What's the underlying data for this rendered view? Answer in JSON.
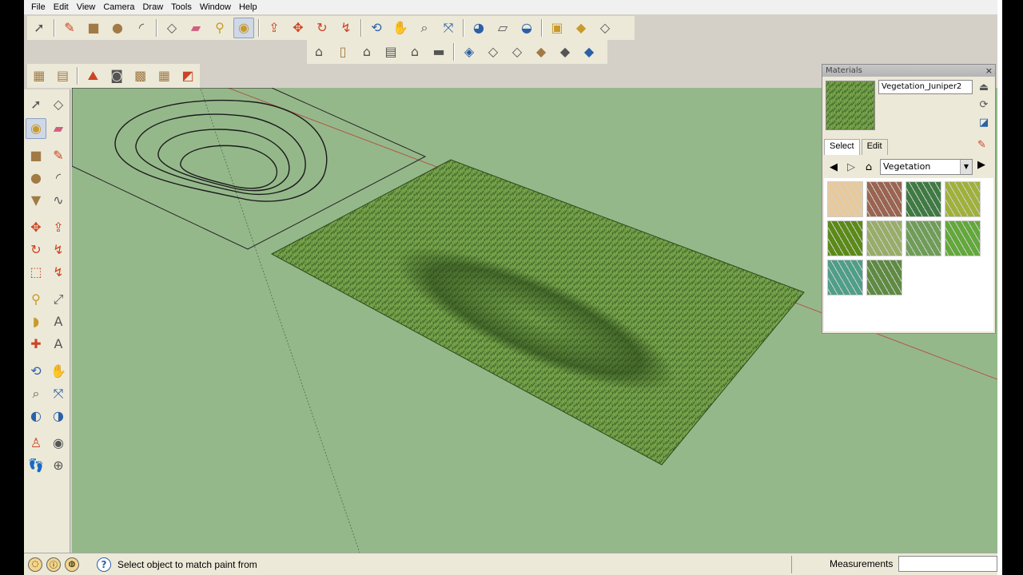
{
  "menu": [
    "File",
    "Edit",
    "View",
    "Camera",
    "Draw",
    "Tools",
    "Window",
    "Help"
  ],
  "toolbar_icons": [
    "select-icon",
    "pencil-icon",
    "rectangle-icon",
    "circle-icon",
    "arc-icon",
    "eraser-icon",
    "paint-bucket-icon",
    "push-pull-icon",
    "move-icon",
    "rotate-icon",
    "offset-icon",
    "orbit-icon",
    "pan-icon",
    "zoom-icon",
    "zoom-extents-icon"
  ],
  "materials_panel": {
    "title": "Materials",
    "close": "×",
    "name_value": "Vegetation_Juniper2",
    "tabs": [
      "Select",
      "Edit"
    ],
    "library": "Vegetation",
    "swatch_colors": [
      "#e8c99a",
      "#9a6450",
      "#3f7a43",
      "#9fb13a",
      "#5b8a18",
      "#97ad68",
      "#6f9d58",
      "#62a83a",
      "#4f9e88",
      "#5f8a42"
    ]
  },
  "status": {
    "message": "Select object to match paint from",
    "measurements_label": "Measurements"
  },
  "colors": {
    "ground": "#95b88b",
    "grass_dark": "#3f6a28",
    "grass_light": "#6f9a45",
    "axis_red": "#b05a4a"
  }
}
